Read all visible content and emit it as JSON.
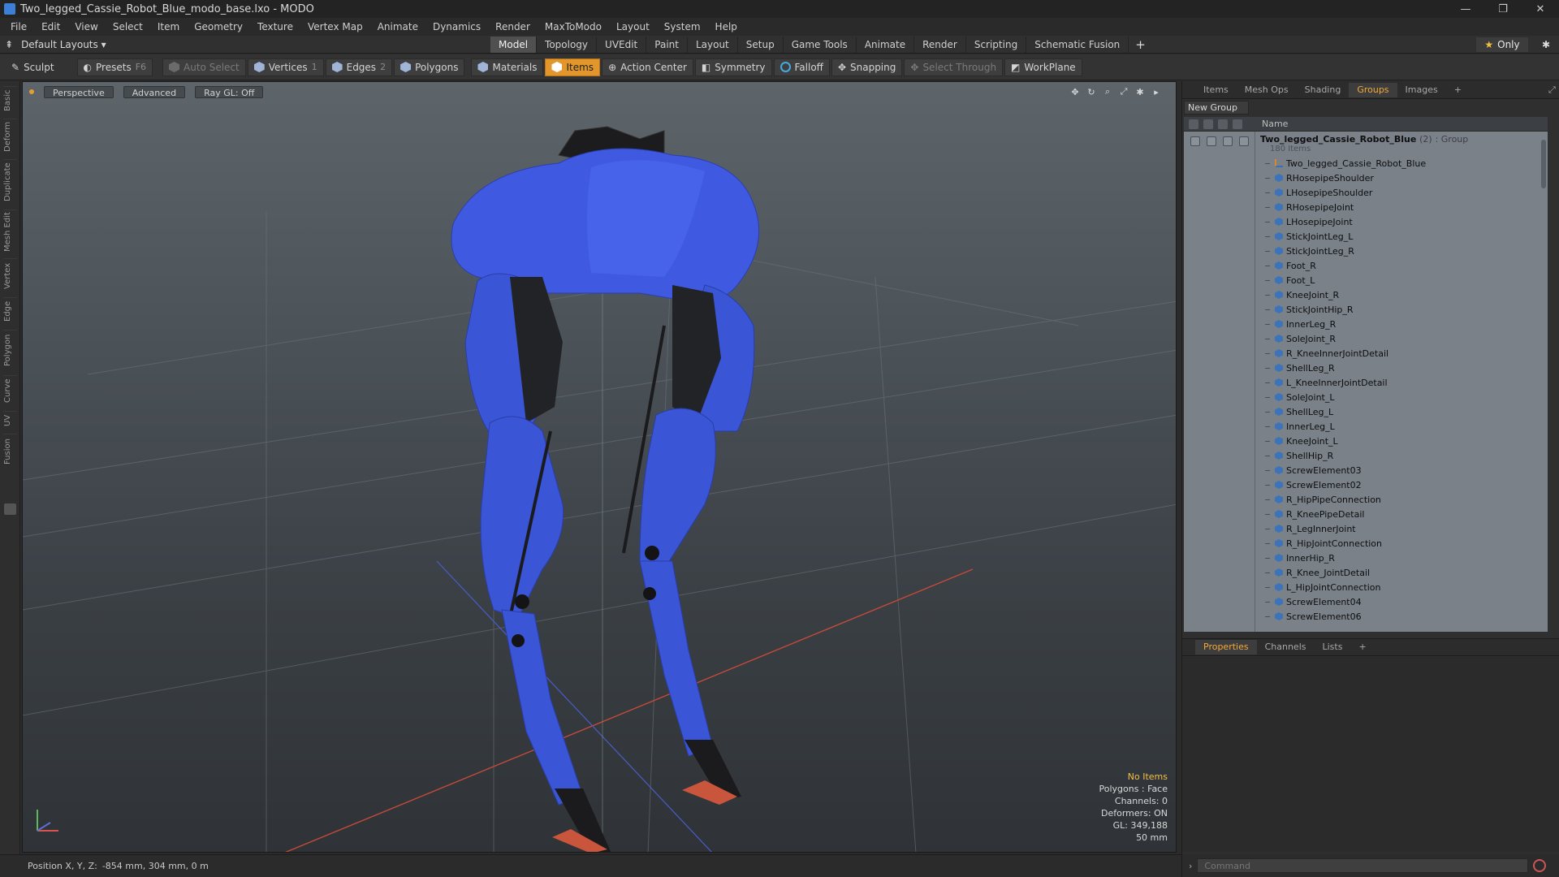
{
  "window": {
    "title": "Two_legged_Cassie_Robot_Blue_modo_base.lxo - MODO",
    "minimize": "—",
    "restore": "❐",
    "close": "✕"
  },
  "menu": [
    "File",
    "Edit",
    "View",
    "Select",
    "Item",
    "Geometry",
    "Texture",
    "Vertex Map",
    "Animate",
    "Dynamics",
    "Render",
    "MaxToModo",
    "Layout",
    "System",
    "Help"
  ],
  "layouts": {
    "label": "Default Layouts ▾"
  },
  "mode_tabs": [
    "Model",
    "Topology",
    "UVEdit",
    "Paint",
    "Layout",
    "Setup",
    "Game Tools",
    "Animate",
    "Render",
    "Scripting",
    "Schematic Fusion"
  ],
  "active_mode": "Model",
  "only_label": "Only",
  "toolbar": {
    "sculpt": "Sculpt",
    "presets": "Presets",
    "presets_key": "F6",
    "auto_select": "Auto Select",
    "vertices": "Vertices",
    "vertices_key": "1",
    "edges": "Edges",
    "edges_key": "2",
    "polygons": "Polygons",
    "materials": "Materials",
    "items": "Items",
    "action_center": "Action Center",
    "symmetry": "Symmetry",
    "falloff": "Falloff",
    "snapping": "Snapping",
    "select_through": "Select Through",
    "workplane": "WorkPlane"
  },
  "left_tabs": [
    "Basic",
    "Deform",
    "Duplicate",
    "Mesh Edit",
    "Vertex",
    "Edge",
    "Polygon",
    "Curve",
    "UV",
    "Fusion"
  ],
  "viewport": {
    "perspective": "Perspective",
    "advanced": "Advanced",
    "raygl": "Ray GL: Off",
    "info": {
      "no_items": "No Items",
      "polygons": "Polygons : Face",
      "channels": "Channels: 0",
      "deformers": "Deformers: ON",
      "gl": "GL: 349,188",
      "focal": "50 mm"
    }
  },
  "status": {
    "position_label": "Position X, Y, Z:",
    "position_value": "-854 mm, 304 mm, 0 m"
  },
  "right_tabs": [
    "Items",
    "Mesh Ops",
    "Shading",
    "Groups",
    "Images"
  ],
  "active_right_tab": "Groups",
  "groups": {
    "new_group": "New Group",
    "name_header": "Name",
    "group_name": "Two_legged_Cassie_Robot_Blue",
    "group_count": "(2)",
    "group_type": ": Group",
    "group_items": "180 Items",
    "items": [
      "Two_legged_Cassie_Robot_Blue",
      "RHosepipeShoulder",
      "LHosepipeShoulder",
      "RHosepipeJoint",
      "LHosepipeJoint",
      "StickJointLeg_L",
      "StickJointLeg_R",
      "Foot_R",
      "Foot_L",
      "KneeJoint_R",
      "StickJointHip_R",
      "InnerLeg_R",
      "SoleJoint_R",
      "R_KneeInnerJointDetail",
      "ShellLeg_R",
      "L_KneeInnerJointDetail",
      "SoleJoint_L",
      "ShellLeg_L",
      "InnerLeg_L",
      "KneeJoint_L",
      "ShellHip_R",
      "ScrewElement03",
      "ScrewElement02",
      "R_HipPipeConnection",
      "R_KneePipeDetail",
      "R_LegInnerJoint",
      "R_HipJointConnection",
      "InnerHip_R",
      "R_Knee_JointDetail",
      "L_HipJointConnection",
      "ScrewElement04",
      "ScrewElement06"
    ]
  },
  "prop_tabs": [
    "Properties",
    "Channels",
    "Lists"
  ],
  "active_prop_tab": "Properties",
  "command": {
    "placeholder": "Command"
  },
  "colors": {
    "accent": "#e3962b",
    "robot_blue": "#3f5ae0",
    "viewport_top": "#5d656b"
  }
}
